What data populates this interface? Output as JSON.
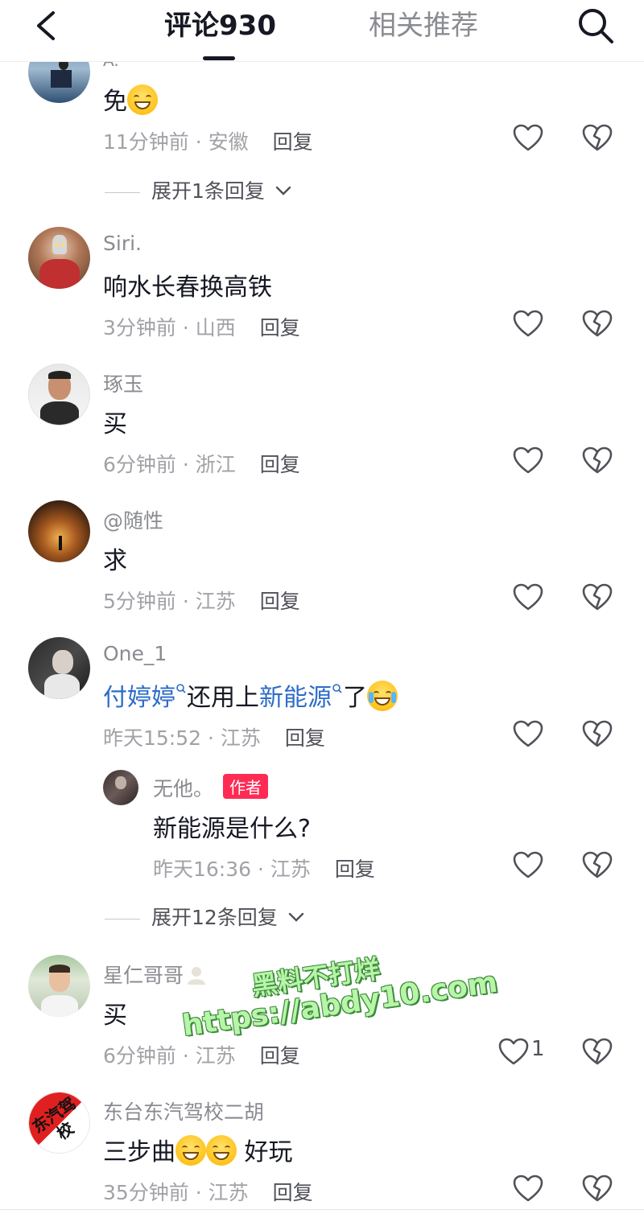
{
  "header": {
    "tab_comments": "评论930",
    "tab_related": "相关推荐"
  },
  "comments": [
    {
      "name": "A.",
      "text": "免",
      "time": "11分钟前 · 安徽",
      "reply": "回复",
      "expand": "展开1条回复"
    },
    {
      "name": "Siri.",
      "text": "响水长春换高铁",
      "time": "3分钟前 · 山西",
      "reply": "回复"
    },
    {
      "name": "琢玉",
      "text": "买",
      "time": "6分钟前 · 浙江",
      "reply": "回复"
    },
    {
      "name": "@随性",
      "text": "求",
      "time": "5分钟前 · 江苏",
      "reply": "回复"
    },
    {
      "name": "One_1",
      "text_link1": "付婷婷",
      "text_mid": "还用上",
      "text_link2": "新能源",
      "text_end": "了",
      "time": "昨天15:52 · 江苏",
      "reply": "回复",
      "sub_reply": {
        "name": "无他。",
        "badge": "作者",
        "text": "新能源是什么?",
        "time": "昨天16:36 · 江苏",
        "reply": "回复"
      },
      "expand": "展开12条回复"
    },
    {
      "name": "星仁哥哥",
      "text": "买",
      "time": "6分钟前 · 江苏",
      "reply": "回复",
      "likes": "1"
    },
    {
      "name": "东台东汽驾校二胡",
      "text_before": "三步曲",
      "text_after": " 好玩",
      "time": "35分钟前 · 江苏",
      "reply": "回复",
      "avatar_text": "东汽驾校"
    }
  ],
  "watermark": {
    "line1": "黑料不打烊",
    "line2": "https://abdy10.com"
  },
  "colors": {
    "accent": "#fe2c55",
    "link": "#2c6cc8",
    "text_primary": "#161823",
    "text_secondary": "#8a8b91"
  },
  "icons": [
    "back-icon",
    "search-icon",
    "heart-icon",
    "broken-heart-icon",
    "chevron-down-icon",
    "search-tag-icon"
  ]
}
